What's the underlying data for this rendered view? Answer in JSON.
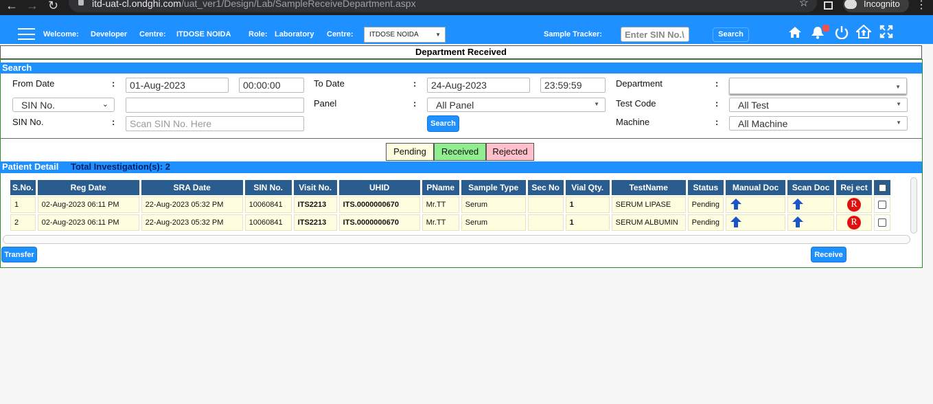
{
  "browser": {
    "url_host": "itd-uat-cl.ondghi.com",
    "url_path": "/uat_ver1/Design/Lab/SampleReceiveDepartment.aspx",
    "incognito_label": "Incognito"
  },
  "header": {
    "welcome_label": "Welcome:",
    "welcome_value": "Developer",
    "centre_label": "Centre:",
    "centre_value": "ITDOSE NOIDA",
    "role_label": "Role:",
    "role_value": "Laboratory",
    "centre2_label": "Centre:",
    "centre_select": "ITDOSE NOIDA",
    "tracker_label": "Sample Tracker:",
    "tracker_placeholder": "Enter SIN No.\\",
    "search_button": "Search",
    "icons": [
      "home-icon",
      "bell-icon",
      "power-icon",
      "upload-home-icon",
      "fullscreen-icon"
    ]
  },
  "page_title": "Department Received",
  "search": {
    "section_title": "Search",
    "from_date_label": "From Date",
    "from_date": "01-Aug-2023",
    "from_time": "00:00:00",
    "to_date_label": "To Date",
    "to_date": "24-Aug-2023",
    "to_time": "23:59:59",
    "department_label": "Department",
    "department_value": "",
    "sin_type_select": "SIN No.",
    "sin_type_value": "",
    "panel_label": "Panel",
    "panel_value": "All Panel",
    "test_code_label": "Test Code",
    "test_code_value": "All Test",
    "sin_label": "SIN No.",
    "sin_placeholder": "Scan SIN No. Here",
    "search_button": "Search",
    "machine_label": "Machine",
    "machine_value": "All Machine",
    "colon": ":"
  },
  "tabs": [
    {
      "label": "Pending",
      "color": "#fffde0"
    },
    {
      "label": "Received",
      "color": "#90ee90"
    },
    {
      "label": "Rejected",
      "color": "#ffc0cb"
    }
  ],
  "patient": {
    "section_title": "Patient Detail",
    "total_label": "Total Investigation(s): 2"
  },
  "table": {
    "columns": [
      "S.No.",
      "Reg Date",
      "SRA Date",
      "SIN No.",
      "Visit No.",
      "UHID",
      "PName",
      "Sample Type",
      "Sec No",
      "Vial Qty.",
      "TestName",
      "Status",
      "Manual Doc",
      "Scan Doc",
      "Rej ect"
    ],
    "rows": [
      {
        "sno": "1",
        "reg_date": "02-Aug-2023 06:11 PM",
        "sra_date": "22-Aug-2023 05:32 PM",
        "sin": "10060841",
        "visit": "ITS2213",
        "uhid": "ITS.0000000670",
        "pname": "Mr.TT",
        "sample_type": "Serum",
        "sec_no": "",
        "vial_qty": "1",
        "test_name": "SERUM LIPASE",
        "status": "Pending",
        "reject_badge": "R"
      },
      {
        "sno": "2",
        "reg_date": "02-Aug-2023 06:11 PM",
        "sra_date": "22-Aug-2023 05:32 PM",
        "sin": "10060841",
        "visit": "ITS2213",
        "uhid": "ITS.0000000670",
        "pname": "Mr.TT",
        "sample_type": "Serum",
        "sec_no": "",
        "vial_qty": "1",
        "test_name": "SERUM ALBUMIN",
        "status": "Pending",
        "reject_badge": "R"
      }
    ]
  },
  "buttons": {
    "transfer": "Transfer",
    "receive": "Receive"
  },
  "colors": {
    "brand": "#1e90ff",
    "table_header": "#2a5d8e",
    "row_bg": "#fffde0"
  }
}
